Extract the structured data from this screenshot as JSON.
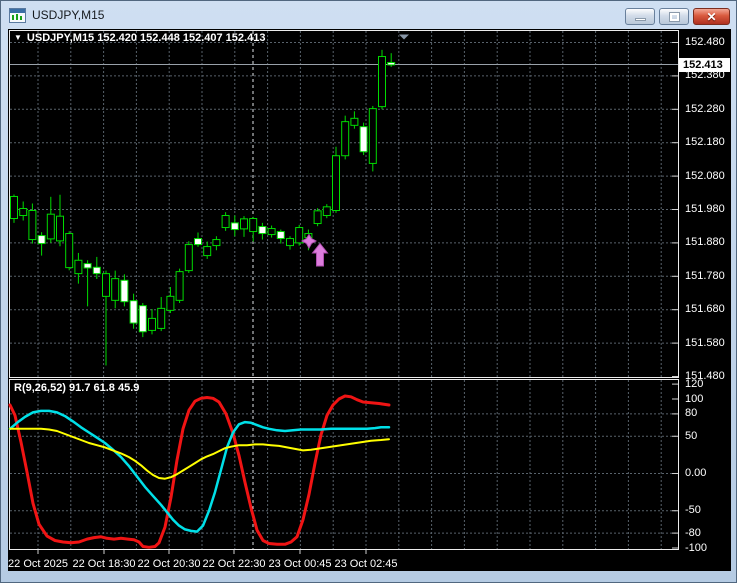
{
  "window": {
    "title": "USDJPY,M15",
    "controls": {
      "minimize_label": "minimize",
      "restore_label": "restore",
      "close_label": "close",
      "close_glyph": "✕"
    }
  },
  "chart_header": {
    "collapse_glyph": "▼",
    "text": "USDJPY,M15 152.420 152.448 152.407 152.413"
  },
  "price_axis": {
    "current_price": "152.413",
    "ticks": [
      152.48,
      152.38,
      152.28,
      152.18,
      152.08,
      151.98,
      151.88,
      151.78,
      151.68,
      151.58,
      151.48
    ]
  },
  "time_axis": {
    "labels": [
      "22 Oct 2025",
      "22 Oct 18:30",
      "22 Oct 20:30",
      "22 Oct 22:30",
      "23 Oct 00:45",
      "23 Oct 02:45"
    ]
  },
  "indicator_panel": {
    "label": "R(9,26,52) 91.7 61.8 45.9",
    "ticks": [
      {
        "v": 120,
        "text": "120"
      },
      {
        "v": 100,
        "text": "100"
      },
      {
        "v": 80,
        "text": "80"
      },
      {
        "v": 50,
        "text": "50"
      },
      {
        "v": 0,
        "text": "0.00"
      },
      {
        "v": -50,
        "text": "-50"
      },
      {
        "v": -80,
        "text": "-80"
      },
      {
        "v": -100,
        "text": "-100"
      }
    ]
  },
  "colors": {
    "background": "#000000",
    "grid": "#58626b",
    "day_separator": "#e0e4e8",
    "candle_outline": "#00dc00",
    "bull_fill": "#000000",
    "bear_fill": "#ffffff",
    "bid_line": "#99a1a9",
    "red_line": "#f01414",
    "cyan_line": "#00e0e8",
    "yellow_line": "#ffff00",
    "buy_arrow": "#dd7ddd",
    "axis_text": "#ffffff",
    "plot_border": "#ececec",
    "shift_marker": "#8795a5"
  },
  "markers": {
    "buy_arrow": {
      "candle_index": 32,
      "price_near": 151.86
    },
    "shift_triangle": {
      "x": 403
    }
  },
  "day_separator_x": 252,
  "chart_data": {
    "type": "candlestick",
    "symbol": "USDJPY",
    "timeframe": "M15",
    "title": "USDJPY,M15",
    "current_bar": {
      "open": 152.42,
      "high": 152.448,
      "low": 152.407,
      "close": 152.413
    },
    "y_range": [
      151.48,
      152.48
    ],
    "x_labels": [
      "22 Oct 2025",
      "22 Oct 18:30",
      "22 Oct 20:30",
      "22 Oct 22:30",
      "23 Oct 00:45",
      "23 Oct 02:45"
    ],
    "candles": [
      [
        151.953,
        152.025,
        151.94,
        152.019
      ],
      [
        151.962,
        152.004,
        151.947,
        151.983
      ],
      [
        151.89,
        151.998,
        151.878,
        151.977
      ],
      [
        151.902,
        151.912,
        151.842,
        151.878
      ],
      [
        151.892,
        152.018,
        151.88,
        151.966
      ],
      [
        151.886,
        152.024,
        151.87,
        151.96
      ],
      [
        151.806,
        151.915,
        151.798,
        151.908
      ],
      [
        151.788,
        151.85,
        151.758,
        151.828
      ],
      [
        151.818,
        151.828,
        151.69,
        151.805
      ],
      [
        151.807,
        151.838,
        151.772,
        151.788
      ],
      [
        151.72,
        151.797,
        151.513,
        151.788
      ],
      [
        151.708,
        151.797,
        151.684,
        151.773
      ],
      [
        151.768,
        151.786,
        151.69,
        151.704
      ],
      [
        151.707,
        151.728,
        151.623,
        151.64
      ],
      [
        151.692,
        151.7,
        151.598,
        151.614
      ],
      [
        151.618,
        151.682,
        151.606,
        151.654
      ],
      [
        151.624,
        151.718,
        151.616,
        151.684
      ],
      [
        151.678,
        151.748,
        151.67,
        151.72
      ],
      [
        151.708,
        151.803,
        151.7,
        151.794
      ],
      [
        151.797,
        151.885,
        151.79,
        151.875
      ],
      [
        151.893,
        151.911,
        151.868,
        151.875
      ],
      [
        151.842,
        151.884,
        151.832,
        151.869
      ],
      [
        151.872,
        151.9,
        151.858,
        151.89
      ],
      [
        151.926,
        151.972,
        151.916,
        151.962
      ],
      [
        151.94,
        151.962,
        151.9,
        151.92
      ],
      [
        151.922,
        151.96,
        151.898,
        151.952
      ],
      [
        151.914,
        151.958,
        151.884,
        151.953
      ],
      [
        151.929,
        151.94,
        151.89,
        151.908
      ],
      [
        151.905,
        151.932,
        151.896,
        151.923
      ],
      [
        151.914,
        151.92,
        151.878,
        151.893
      ],
      [
        151.872,
        151.9,
        151.86,
        151.893
      ],
      [
        151.88,
        151.934,
        151.872,
        151.926
      ],
      [
        151.896,
        151.92,
        151.858,
        151.908
      ],
      [
        151.938,
        151.984,
        151.93,
        151.976
      ],
      [
        151.962,
        151.996,
        151.954,
        151.988
      ],
      [
        151.977,
        152.168,
        151.97,
        152.141
      ],
      [
        152.141,
        152.261,
        152.13,
        152.243
      ],
      [
        152.232,
        152.274,
        152.222,
        152.253
      ],
      [
        152.228,
        152.24,
        152.143,
        152.153
      ],
      [
        152.118,
        152.29,
        152.094,
        152.282
      ],
      [
        152.288,
        152.458,
        152.28,
        152.438
      ],
      [
        152.42,
        152.448,
        152.407,
        152.413
      ]
    ],
    "oscillator": {
      "name": "R(9,26,52)",
      "current_values": [
        91.7,
        61.8,
        45.9
      ],
      "range": [
        -120,
        120
      ],
      "grid_levels": [
        80,
        50,
        0,
        -50,
        -80
      ],
      "series": [
        {
          "name": "R-fast",
          "color": "#f01414",
          "width": 3,
          "points": [
            [
              9,
              92
            ],
            [
              14,
              78
            ],
            [
              20,
              42
            ],
            [
              26,
              2
            ],
            [
              32,
              -40
            ],
            [
              38,
              -68
            ],
            [
              46,
              -84
            ],
            [
              54,
              -90
            ],
            [
              62,
              -92
            ],
            [
              70,
              -93
            ],
            [
              78,
              -92
            ],
            [
              86,
              -88
            ],
            [
              93,
              -86
            ],
            [
              100,
              -85
            ],
            [
              106,
              -87
            ],
            [
              113,
              -88
            ],
            [
              120,
              -87
            ],
            [
              127,
              -88
            ],
            [
              133,
              -89
            ],
            [
              138,
              -92
            ],
            [
              142,
              -98
            ],
            [
              148,
              -99
            ],
            [
              154,
              -98
            ],
            [
              158,
              -93
            ],
            [
              164,
              -72
            ],
            [
              170,
              -32
            ],
            [
              176,
              18
            ],
            [
              182,
              60
            ],
            [
              188,
              85
            ],
            [
              194,
              97
            ],
            [
              200,
              101
            ],
            [
              206,
              102
            ],
            [
              212,
              101
            ],
            [
              218,
              96
            ],
            [
              225,
              80
            ],
            [
              232,
              54
            ],
            [
              238,
              24
            ],
            [
              244,
              -12
            ],
            [
              250,
              -46
            ],
            [
              256,
              -76
            ],
            [
              262,
              -90
            ],
            [
              268,
              -94
            ],
            [
              276,
              -95
            ],
            [
              284,
              -95
            ],
            [
              290,
              -92
            ],
            [
              296,
              -85
            ],
            [
              302,
              -62
            ],
            [
              308,
              -28
            ],
            [
              314,
              14
            ],
            [
              320,
              52
            ],
            [
              326,
              78
            ],
            [
              332,
              92
            ],
            [
              338,
              100
            ],
            [
              344,
              104
            ],
            [
              350,
              103
            ],
            [
              356,
              99
            ],
            [
              362,
              96
            ],
            [
              370,
              95
            ],
            [
              378,
              94
            ],
            [
              388,
              92
            ]
          ]
        },
        {
          "name": "R-mid",
          "color": "#00e0e8",
          "width": 2.5,
          "points": [
            [
              9,
              60
            ],
            [
              16,
              68
            ],
            [
              24,
              76
            ],
            [
              32,
              82
            ],
            [
              40,
              84
            ],
            [
              48,
              84
            ],
            [
              56,
              82
            ],
            [
              64,
              77
            ],
            [
              72,
              70
            ],
            [
              80,
              62
            ],
            [
              88,
              55
            ],
            [
              96,
              48
            ],
            [
              104,
              41
            ],
            [
              112,
              32
            ],
            [
              120,
              22
            ],
            [
              128,
              10
            ],
            [
              136,
              -4
            ],
            [
              144,
              -18
            ],
            [
              152,
              -30
            ],
            [
              160,
              -42
            ],
            [
              166,
              -52
            ],
            [
              172,
              -62
            ],
            [
              178,
              -70
            ],
            [
              184,
              -75
            ],
            [
              190,
              -77
            ],
            [
              196,
              -78
            ],
            [
              202,
              -70
            ],
            [
              208,
              -50
            ],
            [
              214,
              -25
            ],
            [
              220,
              5
            ],
            [
              226,
              35
            ],
            [
              232,
              55
            ],
            [
              238,
              66
            ],
            [
              244,
              69
            ],
            [
              250,
              68
            ],
            [
              256,
              65
            ],
            [
              262,
              62
            ],
            [
              268,
              60
            ],
            [
              276,
              58
            ],
            [
              284,
              57
            ],
            [
              292,
              58
            ],
            [
              300,
              59
            ],
            [
              310,
              59
            ],
            [
              320,
              59
            ],
            [
              330,
              60
            ],
            [
              342,
              60
            ],
            [
              354,
              60
            ],
            [
              366,
              60
            ],
            [
              374,
              61
            ],
            [
              380,
              62
            ],
            [
              388,
              62
            ]
          ]
        },
        {
          "name": "R-slow",
          "color": "#ffff00",
          "width": 2,
          "points": [
            [
              9,
              60
            ],
            [
              20,
              60
            ],
            [
              30,
              60
            ],
            [
              40,
              60
            ],
            [
              48,
              59
            ],
            [
              56,
              57
            ],
            [
              64,
              53
            ],
            [
              72,
              49
            ],
            [
              80,
              45
            ],
            [
              88,
              41
            ],
            [
              96,
              38
            ],
            [
              104,
              35
            ],
            [
              112,
              31
            ],
            [
              120,
              27
            ],
            [
              128,
              22
            ],
            [
              134,
              17
            ],
            [
              140,
              11
            ],
            [
              146,
              4
            ],
            [
              152,
              -2
            ],
            [
              158,
              -6
            ],
            [
              164,
              -7
            ],
            [
              170,
              -5
            ],
            [
              176,
              -1
            ],
            [
              182,
              4
            ],
            [
              188,
              9
            ],
            [
              194,
              14
            ],
            [
              200,
              19
            ],
            [
              206,
              23
            ],
            [
              212,
              26
            ],
            [
              218,
              30
            ],
            [
              224,
              34
            ],
            [
              230,
              36
            ],
            [
              238,
              38
            ],
            [
              246,
              38
            ],
            [
              254,
              39
            ],
            [
              262,
              39
            ],
            [
              270,
              38
            ],
            [
              278,
              37
            ],
            [
              286,
              35
            ],
            [
              294,
              33
            ],
            [
              302,
              31
            ],
            [
              310,
              32
            ],
            [
              320,
              34
            ],
            [
              330,
              36
            ],
            [
              340,
              38
            ],
            [
              350,
              40
            ],
            [
              360,
              42
            ],
            [
              370,
              44
            ],
            [
              380,
              45
            ],
            [
              388,
              46
            ]
          ]
        }
      ]
    }
  }
}
